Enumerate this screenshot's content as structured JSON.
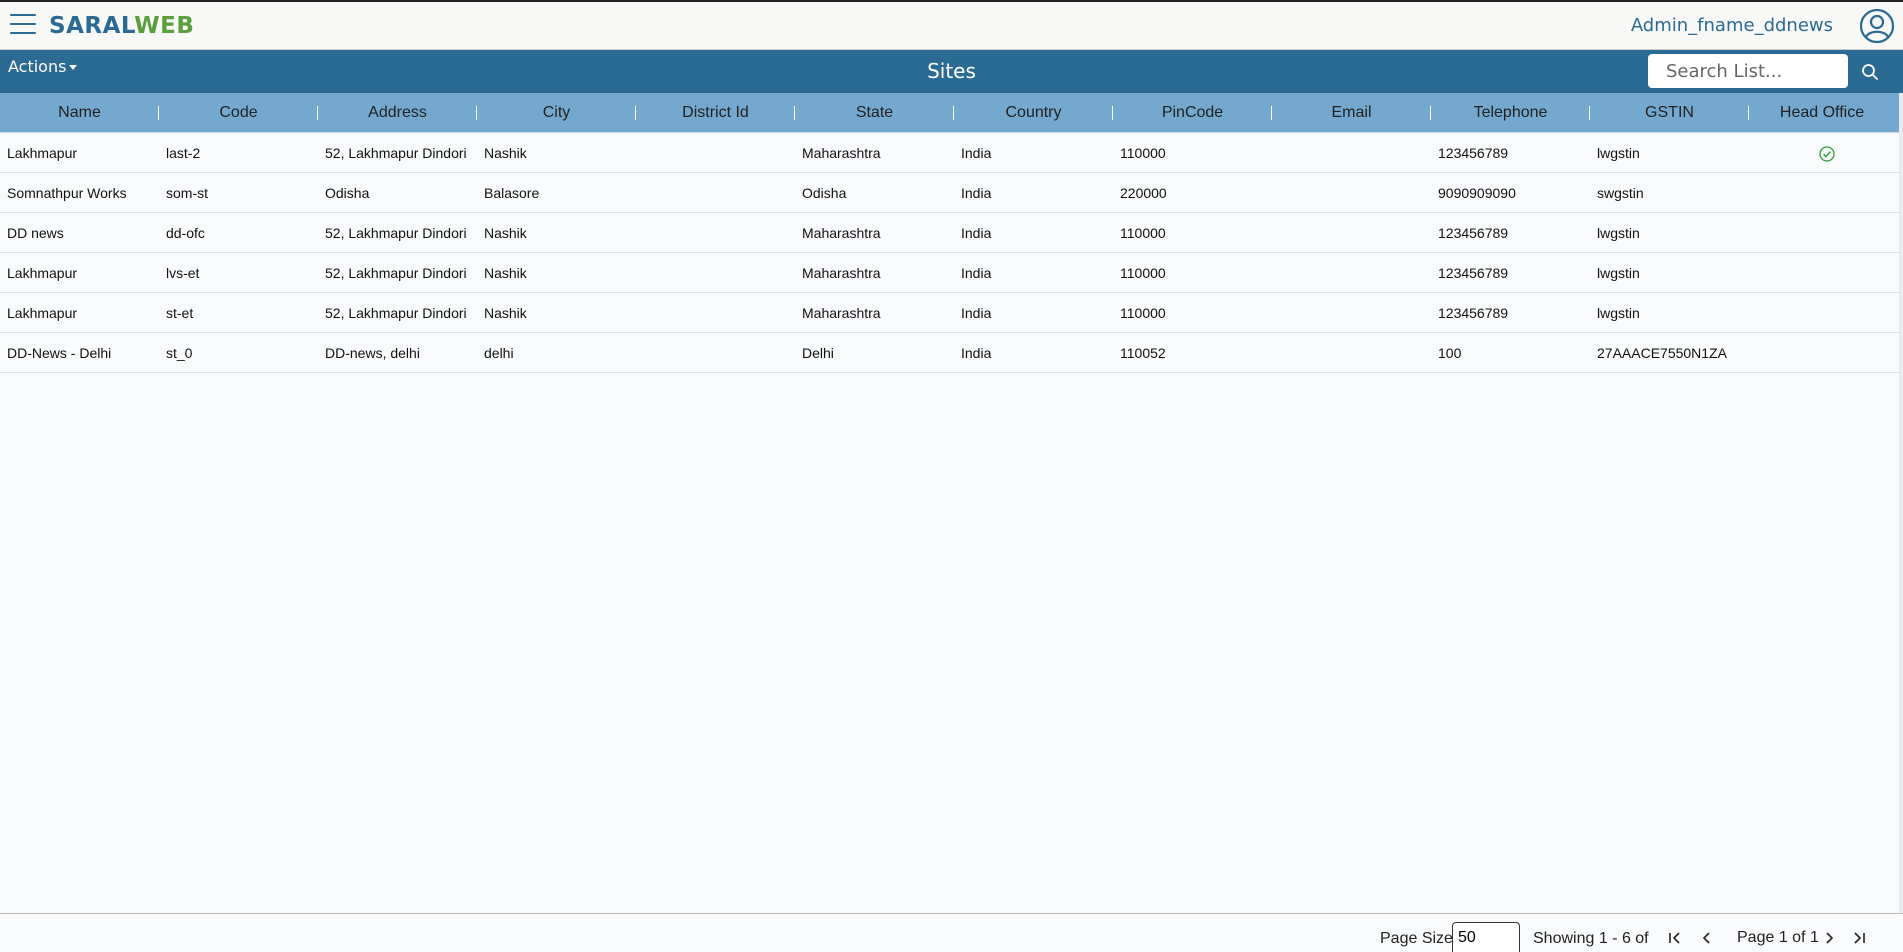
{
  "app": {
    "logo_part1": "SARAL",
    "logo_part2": "WEB",
    "username": "Admin_fname_ddnews",
    "brand_color": "#2b6a92",
    "accent_color": "#5b9e3f"
  },
  "toolbar": {
    "actions_label": "Actions",
    "page_title": "Sites",
    "search_placeholder": "Search List..."
  },
  "table": {
    "columns": [
      "Name",
      "Code",
      "Address",
      "City",
      "District Id",
      "State",
      "Country",
      "PinCode",
      "Email",
      "Telephone",
      "GSTIN",
      "Head Office"
    ],
    "rows": [
      {
        "name": "Lakhmapur",
        "code": "last-2",
        "address": "52, Lakhmapur Dindori",
        "city": "Nashik",
        "district": "",
        "state": "Maharashtra",
        "country": "India",
        "pincode": "110000",
        "email": "",
        "telephone": "123456789",
        "gstin": "lwgstin",
        "head_office": true
      },
      {
        "name": "Somnathpur Works",
        "code": "som-st",
        "address": "Odisha",
        "city": "Balasore",
        "district": "",
        "state": "Odisha",
        "country": "India",
        "pincode": "220000",
        "email": "",
        "telephone": "9090909090",
        "gstin": "swgstin",
        "head_office": false
      },
      {
        "name": "DD news",
        "code": "dd-ofc",
        "address": "52, Lakhmapur Dindori",
        "city": "Nashik",
        "district": "",
        "state": "Maharashtra",
        "country": "India",
        "pincode": "110000",
        "email": "",
        "telephone": "123456789",
        "gstin": "lwgstin",
        "head_office": false
      },
      {
        "name": "Lakhmapur",
        "code": "lvs-et",
        "address": "52, Lakhmapur Dindori",
        "city": "Nashik",
        "district": "",
        "state": "Maharashtra",
        "country": "India",
        "pincode": "110000",
        "email": "",
        "telephone": "123456789",
        "gstin": "lwgstin",
        "head_office": false
      },
      {
        "name": "Lakhmapur",
        "code": "st-et",
        "address": "52, Lakhmapur Dindori",
        "city": "Nashik",
        "district": "",
        "state": "Maharashtra",
        "country": "India",
        "pincode": "110000",
        "email": "",
        "telephone": "123456789",
        "gstin": "lwgstin",
        "head_office": false
      },
      {
        "name": "DD-News - Delhi",
        "code": "st_0",
        "address": "DD-news, delhi",
        "city": "delhi",
        "district": "",
        "state": "Delhi",
        "country": "India",
        "pincode": "110052",
        "email": "",
        "telephone": "100",
        "gstin": "27AAACE7550N1ZA",
        "head_office": false
      }
    ]
  },
  "pagination": {
    "page_size_label": "Page Size",
    "page_size": "50",
    "showing": "Showing 1 - 6 of",
    "page_of": "Page 1 of 1"
  },
  "icons": {
    "menu": "hamburger-icon",
    "user": "user-circle-icon",
    "search": "search-icon",
    "head_office": "check-circle-icon",
    "first": "first-page-icon",
    "prev": "prev-page-icon",
    "next": "next-page-icon",
    "last": "last-page-icon"
  }
}
